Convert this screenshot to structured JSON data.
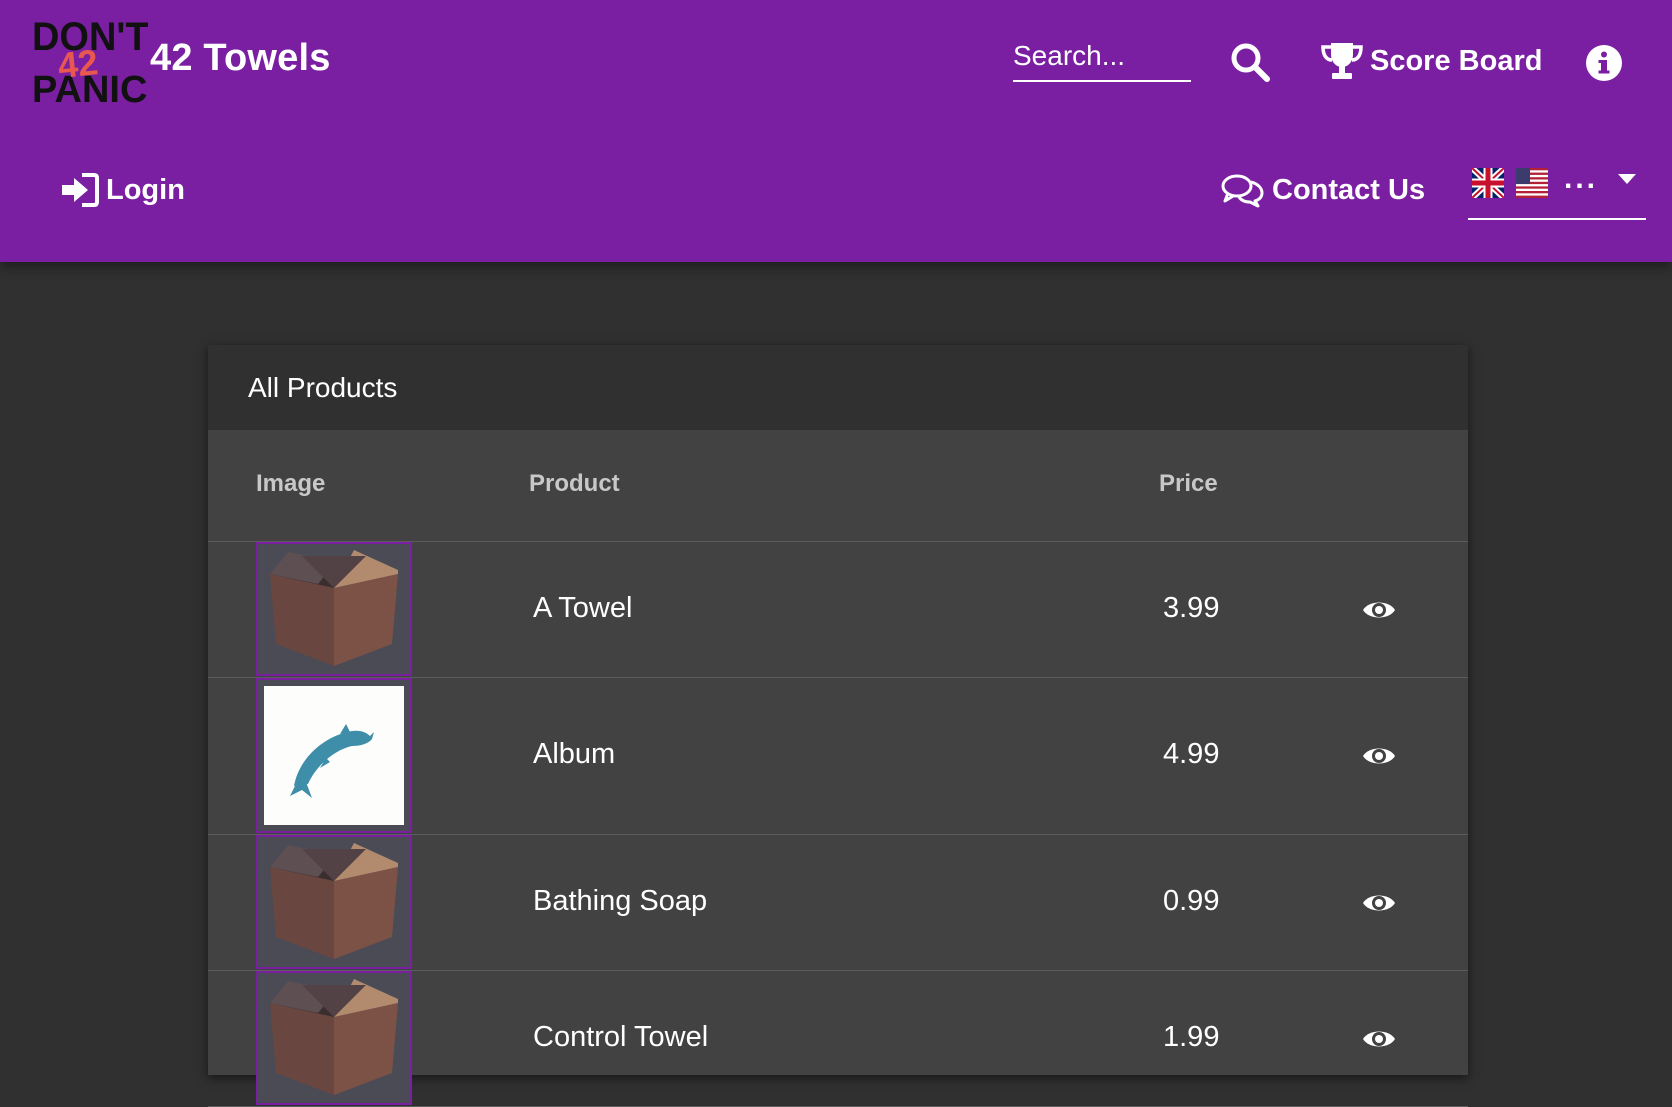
{
  "header": {
    "logo": {
      "text_top": "DON'T",
      "text_number": "42",
      "text_bottom": "PANIC"
    },
    "app_name": "42 Towels",
    "search": {
      "placeholder": "Search..."
    },
    "score_board_label": "Score Board",
    "login_label": "Login",
    "contact_label": "Contact Us",
    "language": {
      "flags": [
        "uk-flag-icon",
        "us-flag-icon"
      ],
      "more": "..."
    }
  },
  "colors": {
    "toolbar": "#7b1fa2",
    "background": "#303030",
    "card": "#424242",
    "accent_border": "#7b1fa2"
  },
  "products": {
    "title": "All Products",
    "columns": {
      "image": "Image",
      "product": "Product",
      "price": "Price"
    },
    "rows": [
      {
        "image": "box-image",
        "name": "A Towel",
        "price": "3.99",
        "action": "eye-icon"
      },
      {
        "image": "dolphin-album-image",
        "name": "Album",
        "price": "4.99",
        "action": "eye-icon"
      },
      {
        "image": "box-image",
        "name": "Bathing Soap",
        "price": "0.99",
        "action": "eye-icon"
      },
      {
        "image": "box-image",
        "name": "Control Towel",
        "price": "1.99",
        "action": "eye-icon"
      }
    ]
  }
}
